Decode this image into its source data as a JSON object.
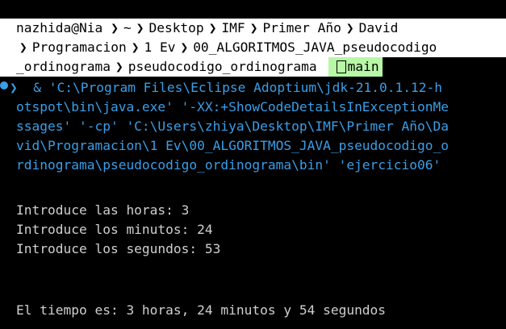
{
  "prompt": {
    "user": "nazhida@Nia",
    "path_segments": [
      "~",
      "Desktop",
      "IMF",
      "Primer Año",
      "David",
      "Programacion",
      "1 Ev",
      "00_ALGORITMOS_JAVA_pseudocodigo",
      "_ordinograma",
      "pseudocodigo_ordinograma"
    ],
    "git_branch": "main",
    "branch_icon": "git-branch-icon",
    "separator": "❯"
  },
  "command": {
    "chevron": "❯",
    "lines": [
      "  & 'C:\\Program Files\\Eclipse Adoptium\\jdk-21.0.1.12-h",
      "otspot\\bin\\java.exe' '-XX:+ShowCodeDetailsInExceptionMe",
      "ssages' '-cp' 'C:\\Users\\zhiya\\Desktop\\IMF\\Primer Año\\Da",
      "vid\\Programacion\\1 Ev\\00_ALGORITMOS_JAVA_pseudocodigo_o",
      "rdinograma\\pseudocodigo_ordinograma\\bin' 'ejercicio06'"
    ]
  },
  "output": {
    "lines": [
      "Introduce las horas: 3",
      "Introduce los minutos: 24",
      "Introduce los segundos: 53",
      "El tiempo es: 3 horas, 24 minutos y 54 segundos"
    ]
  },
  "colors": {
    "background": "#000000",
    "prompt_bg": "#ffffff",
    "git_bg": "#b7f7a6",
    "command_text": "#3a9ee8",
    "output_text": "#cfcfcf"
  }
}
